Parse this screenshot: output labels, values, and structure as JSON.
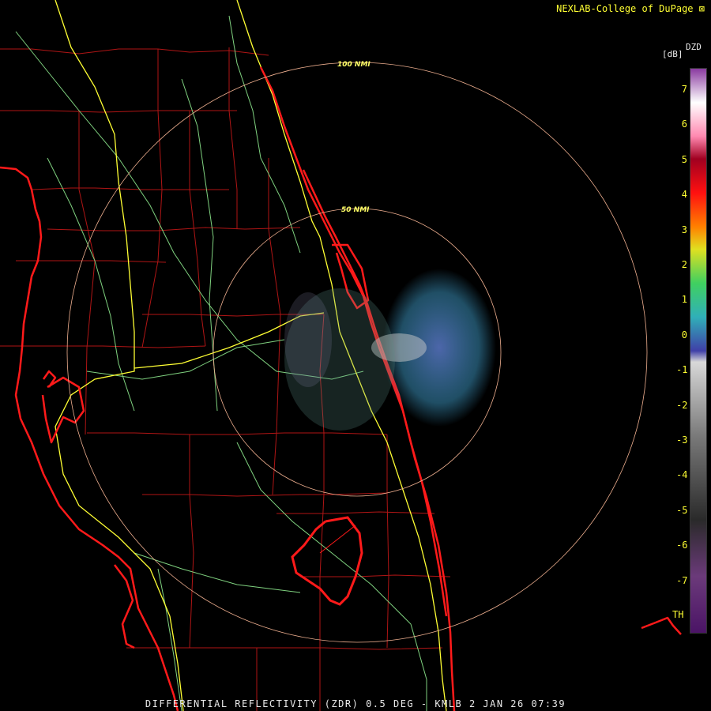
{
  "header": {
    "credit": "NEXLAB-College of DuPage"
  },
  "footer": {
    "caption": "DIFFERENTIAL REFLECTIVITY (ZDR) 0.5 DEG - KMLB 2 JAN 26 07:39"
  },
  "range_rings": {
    "inner_label": "50 NMI",
    "outer_label": "100 NMI"
  },
  "scale": {
    "name": "DZD",
    "unit": "[dB]",
    "ticks": [
      "7",
      "6",
      "5",
      "4",
      "3",
      "2",
      "1",
      "0",
      "-1",
      "-2",
      "-3",
      "-4",
      "-5",
      "-6",
      "-7"
    ],
    "footer_label": "TH"
  },
  "colors": {
    "background": "#000000",
    "coastline": "#ff1a1a",
    "county_lines": "#b01515",
    "interstates": "#ffff33",
    "highways": "#7fd17f",
    "range_ring": "#f0b090"
  }
}
